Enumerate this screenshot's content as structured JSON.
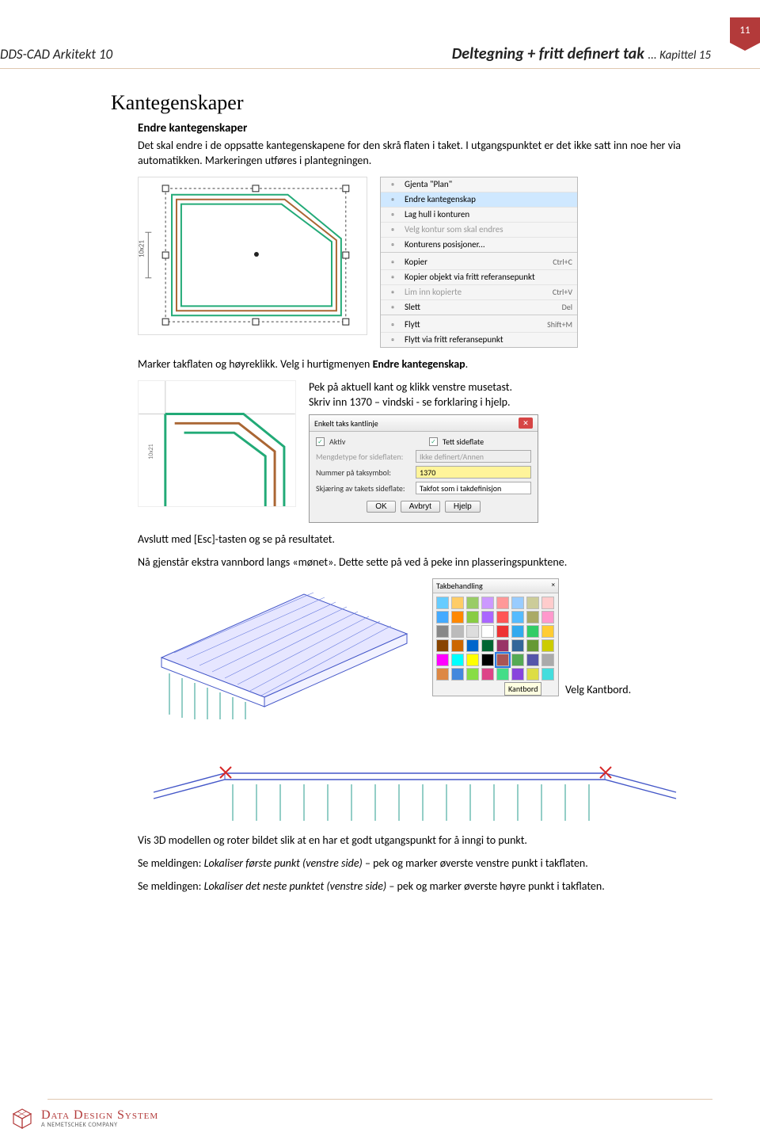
{
  "page_number": "11",
  "header": {
    "app_left": "DDS-CAD Arkitekt 10",
    "title_right": "Deltegning + fritt definert tak",
    "chapter": "... Kapittel 15"
  },
  "section_title": "Kantegenskaper",
  "subsection_title": "Endre kantegenskaper",
  "intro_text": "Det skal endre i de oppsatte kantegenskapene for den skrå flaten i taket. I utgangspunktet er det ikke satt inn noe her via automatikken. Markeringen utføres i plantegningen.",
  "context_menu": {
    "items": [
      {
        "icon": "repeat-icon",
        "label": "Gjenta \"Plan\"",
        "shortcut": "",
        "disabled": false
      },
      {
        "icon": "edit-icon",
        "label": "Endre kantegenskap",
        "shortcut": "",
        "highlight": true
      },
      {
        "icon": "hole-icon",
        "label": "Lag hull i konturen",
        "shortcut": ""
      },
      {
        "icon": "select-icon",
        "label": "Velg kontur som skal endres",
        "shortcut": "",
        "disabled": true
      },
      {
        "icon": "position-icon",
        "label": "Konturens posisjoner...",
        "shortcut": ""
      }
    ],
    "items2": [
      {
        "icon": "copy-icon",
        "label": "Kopier",
        "shortcut": "Ctrl+C"
      },
      {
        "icon": "copyref-icon",
        "label": "Kopier objekt via fritt referansepunkt",
        "shortcut": ""
      },
      {
        "icon": "paste-icon",
        "label": "Lim inn kopierte",
        "shortcut": "Ctrl+V",
        "disabled": true
      },
      {
        "icon": "delete-icon",
        "label": "Slett",
        "shortcut": "Del"
      }
    ],
    "items3": [
      {
        "icon": "move-icon",
        "label": "Flytt",
        "shortcut": "Shift+M"
      },
      {
        "icon": "moveref-icon",
        "label": "Flytt via fritt referansepunkt",
        "shortcut": ""
      }
    ]
  },
  "after_fig1_text_pre": "Marker takflaten og høyreklikk. Velg i hurtigmenyen ",
  "after_fig1_text_bold": "Endre kantegenskap",
  "after_fig1_text_post": ".",
  "fig2_text_a": "Pek på aktuell kant og klikk venstre musetast.",
  "fig2_text_b_pre": "Skriv inn ",
  "fig2_text_b_bold": "1370",
  "fig2_text_b_post": " – vindski - se forklaring i hjelp.",
  "dialog": {
    "title": "Enkelt taks kantlinje",
    "aktiv_label": "Aktiv",
    "aktiv_checked": true,
    "tett_label": "Tett sideflate",
    "tett_checked": true,
    "mengdetype_label": "Mengdetype for sideflaten:",
    "mengdetype_value": "Ikke definert/Annen",
    "nummer_label": "Nummer på taksymbol:",
    "nummer_value": "1370",
    "skjaering_label": "Skjæring av takets sideflate:",
    "skjaering_value": "Takfot som i takdefinisjon",
    "btn_ok": "OK",
    "btn_cancel": "Avbryt",
    "btn_help": "Hjelp"
  },
  "after_fig2_text": "Avslutt med [Esc]-tasten og se på resultatet.",
  "para3": "Nå gjenstår ekstra vannbord langs «mønet». Dette sette på ved å peke inn plasseringspunktene.",
  "palette": {
    "title": "Takbehandling",
    "tooltip": "Kantbord"
  },
  "velg_pre": "Velg ",
  "velg_bold": "Kantbord",
  "velg_post": ".",
  "after_ridge": "Vis 3D modellen og roter bildet slik at en har et godt utgangspunkt for å inngi to punkt.",
  "msg1_pre": "Se meldingen: ",
  "msg1_em": "Lokaliser første punkt (venstre side)",
  "msg1_post": " – pek og marker øverste venstre punkt i takflaten.",
  "msg2_pre": "Se meldingen: ",
  "msg2_em": "Lokaliser det neste punktet (venstre side)",
  "msg2_post": " – pek og marker øverste høyre punkt i takflaten.",
  "footer": {
    "company": "Data Design System",
    "tagline": "A NEMETSCHEK COMPANY"
  },
  "roof_plan_label": "10x21"
}
